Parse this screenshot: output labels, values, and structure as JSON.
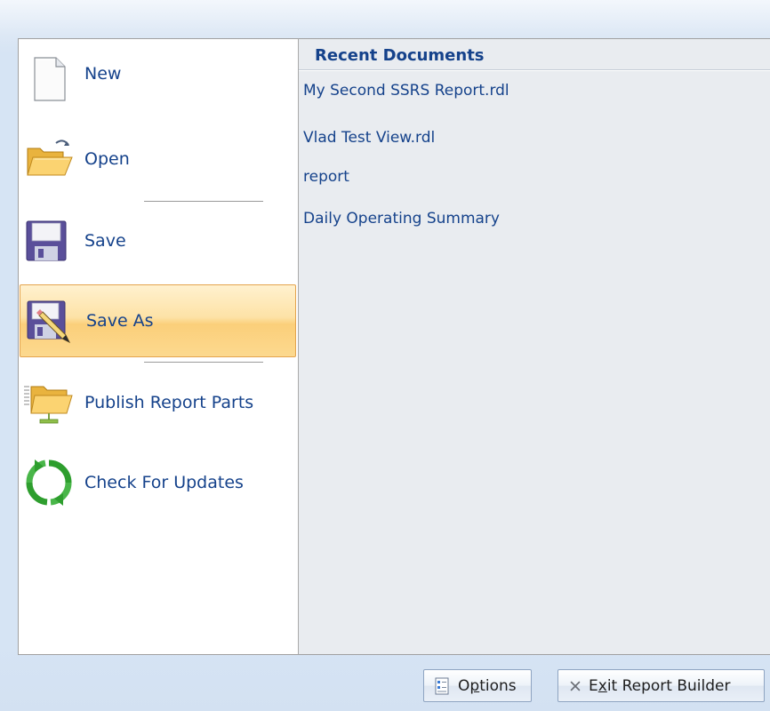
{
  "menu": {
    "items": [
      {
        "label": "New",
        "icon": "new-document-icon",
        "selected": false
      },
      {
        "label": "Open",
        "icon": "open-folder-icon",
        "selected": false
      },
      {
        "label": "Save",
        "icon": "save-disk-icon",
        "selected": false
      },
      {
        "label": "Save As",
        "icon": "save-as-icon",
        "selected": true
      },
      {
        "label": "Publish Report Parts",
        "icon": "publish-folder-icon",
        "selected": false
      },
      {
        "label": "Check For Updates",
        "icon": "check-updates-icon",
        "selected": false
      }
    ]
  },
  "recent": {
    "title": "Recent Documents",
    "items": [
      "My Second SSRS Report.rdl",
      "Vlad Test View.rdl",
      "report",
      "Daily Operating Summary"
    ]
  },
  "footer": {
    "options_label_pre": "O",
    "options_label_u": "p",
    "options_label_post": "tions",
    "exit_label_pre": "E",
    "exit_label_u": "x",
    "exit_label_post": "it Report Builder"
  },
  "colors": {
    "label_text": "#15428b",
    "selected_border": "#e4a34d",
    "selected_fill": "#fde2a6"
  }
}
